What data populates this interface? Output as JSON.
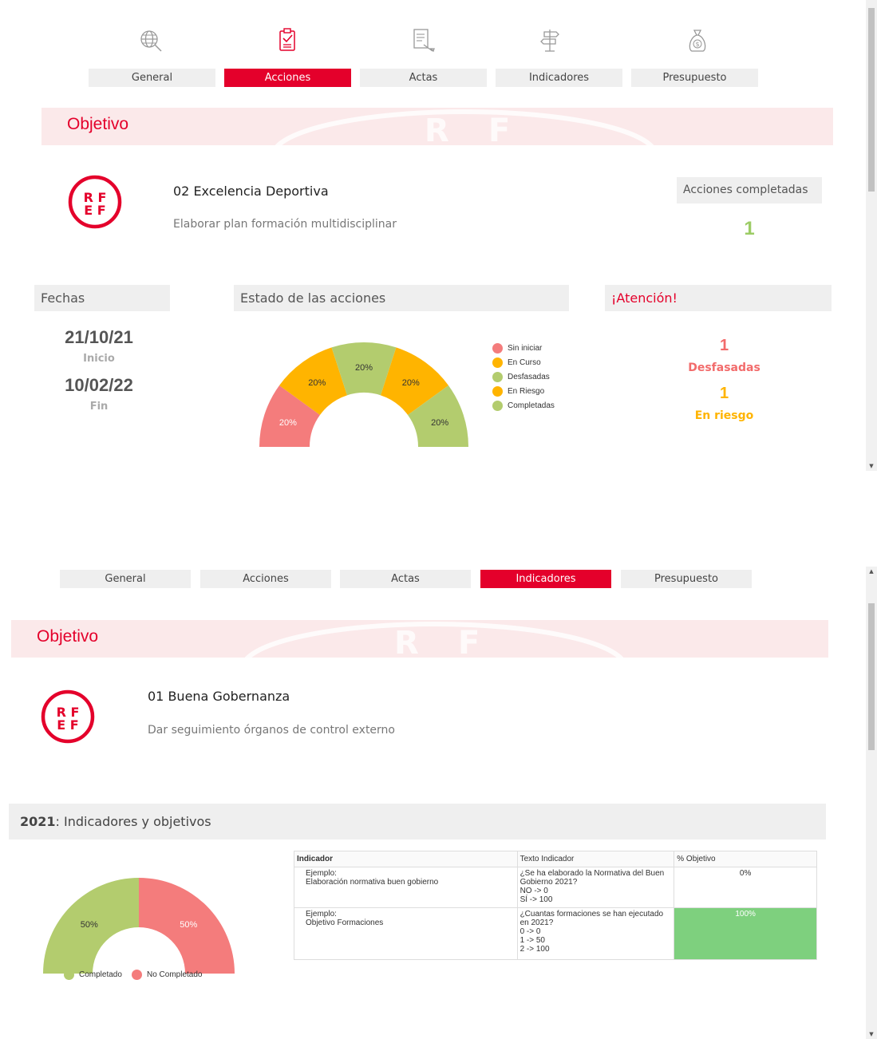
{
  "panel1": {
    "tabs": [
      "General",
      "Acciones",
      "Actas",
      "Indicadores",
      "Presupuesto"
    ],
    "active_tab": "Acciones",
    "icons": [
      "globe-icon",
      "clipboard-check-icon",
      "document-sign-icon",
      "signpost-icon",
      "money-bag-icon"
    ],
    "banner_title": "Objetivo",
    "objective": {
      "title": "02 Excelencia Deportiva",
      "subtitle": "Elaborar plan formación multidisciplinar"
    },
    "completed": {
      "header": "Acciones completadas",
      "value": "1"
    },
    "dates": {
      "header": "Fechas",
      "start": "21/10/21",
      "start_label": "Inicio",
      "end": "10/02/22",
      "end_label": "Fin"
    },
    "status": {
      "header": "Estado de las acciones"
    },
    "attention": {
      "header": "¡Atención!",
      "desfasadas_value": "1",
      "desfasadas_label": "Desfasadas",
      "riesgo_value": "1",
      "riesgo_label": "En riesgo"
    }
  },
  "panel2": {
    "tabs": [
      "General",
      "Acciones",
      "Actas",
      "Indicadores",
      "Presupuesto"
    ],
    "active_tab": "Indicadores",
    "banner_title": "Objetivo",
    "objective": {
      "title": "01 Buena Gobernanza",
      "subtitle": "Dar seguimiento órganos de control externo"
    },
    "year_header": {
      "year": "2021",
      "text": ": Indicadores y objetivos"
    },
    "table": {
      "headers": [
        "Indicador",
        "Texto Indicador",
        "% Objetivo"
      ],
      "rows": [
        {
          "indicador": [
            "Ejemplo:",
            "Elaboración normativa buen gobierno"
          ],
          "texto": [
            "¿Se ha elaborado la Normativa del Buen",
            "Gobierno 2021?",
            "NO -> 0",
            "SÍ -> 100"
          ],
          "objetivo": "0%"
        },
        {
          "indicador": [
            "Ejemplo:",
            "Objetivo Formaciones"
          ],
          "texto": [
            "¿Cuantas formaciones se han ejecutado",
            "en 2021?",
            "0 -> 0",
            "1 -> 50",
            "2 -> 100"
          ],
          "objetivo": "100%"
        }
      ]
    }
  },
  "colors": {
    "brand_red": "#e4002b",
    "sin_iniciar": "#f47c7c",
    "en_curso": "#ffb400",
    "desfasadas": "#b3cc6e",
    "en_riesgo": "#ffb400",
    "completadas": "#b3cc6e",
    "completed_value": "#9ccc65",
    "attention_red": "#f26b6b",
    "attention_orange": "#ffb400",
    "table_green": "#7ed07e"
  },
  "chart_data": [
    {
      "type": "pie",
      "variant": "half-donut",
      "categories": [
        "Sin iniciar",
        "En Curso",
        "Desfasadas",
        "En Riesgo",
        "Completadas"
      ],
      "values": [
        20,
        20,
        20,
        20,
        20
      ],
      "labels": [
        "20%",
        "20%",
        "20%",
        "20%",
        "20%"
      ],
      "colors": [
        "#f47c7c",
        "#ffb400",
        "#b3cc6e",
        "#ffb400",
        "#b3cc6e"
      ],
      "legend": "right"
    },
    {
      "type": "pie",
      "variant": "half-donut",
      "categories": [
        "Completado",
        "No Completado"
      ],
      "values": [
        50,
        50
      ],
      "labels": [
        "50%",
        "50%"
      ],
      "colors": [
        "#b3cc6e",
        "#f47c7c"
      ],
      "legend": "bottom"
    }
  ]
}
